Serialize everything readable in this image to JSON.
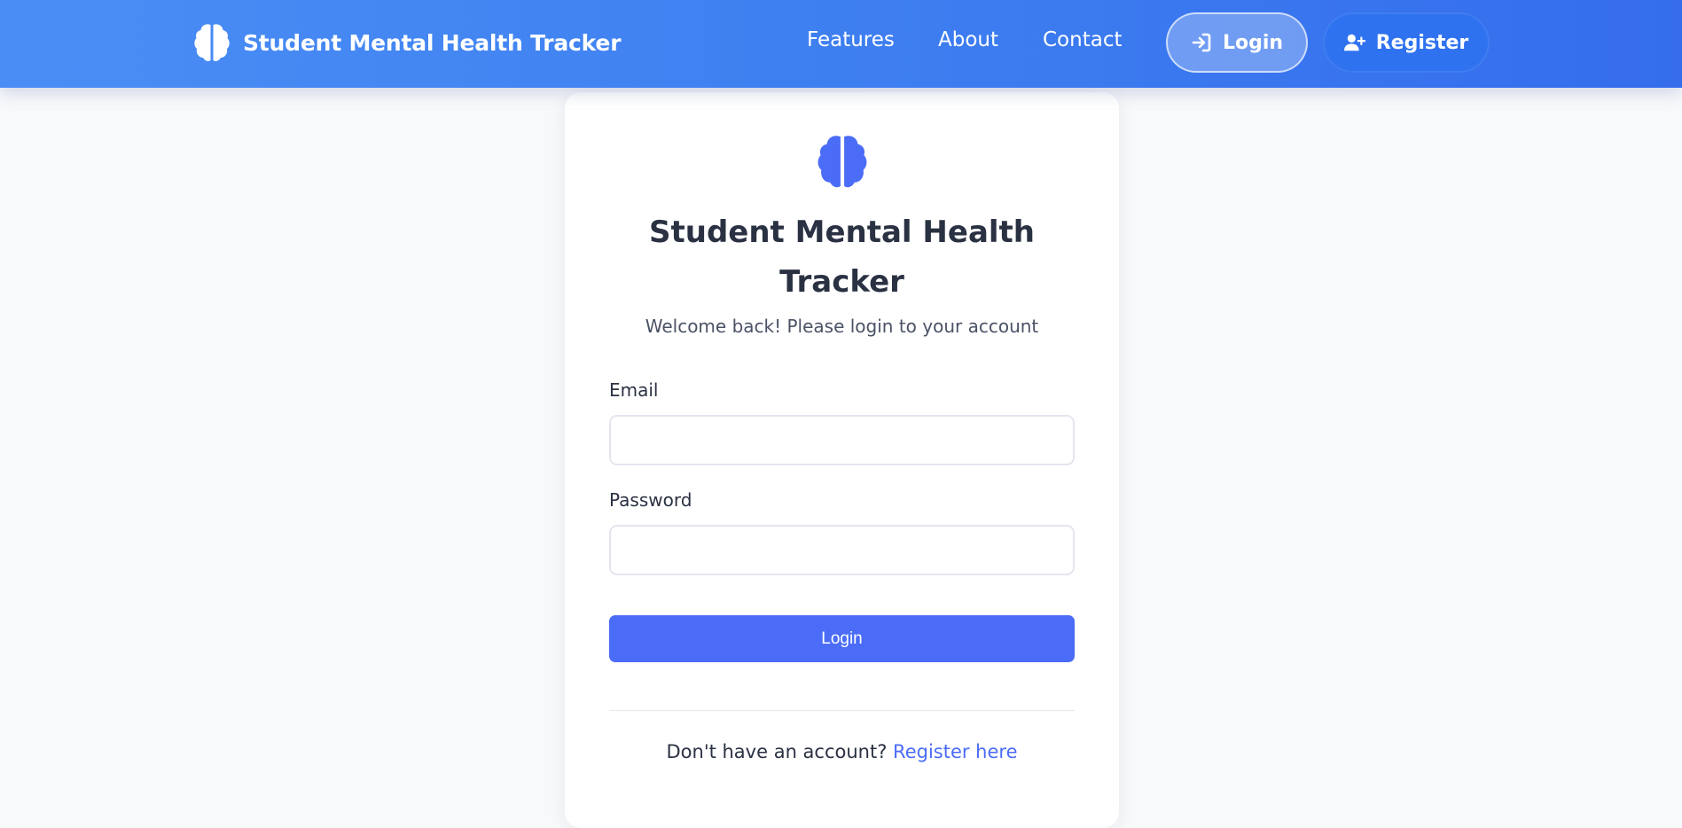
{
  "navbar": {
    "brand_icon": "brain-icon",
    "brand_title": "Student Mental Health Tracker",
    "links": [
      {
        "label": "Features"
      },
      {
        "label": "About"
      },
      {
        "label": "Contact"
      }
    ],
    "login_button": {
      "label": "Login",
      "icon": "sign-in-icon"
    },
    "register_button": {
      "label": "Register",
      "icon": "user-plus-icon"
    },
    "gradient_start": "#4a8ef5",
    "gradient_end": "#356ded"
  },
  "login_card": {
    "icon": "brain-icon",
    "icon_color": "#4a6cf7",
    "title": "Student Mental Health Tracker",
    "subtitle": "Welcome back! Please login to your account",
    "email_label": "Email",
    "email_value": "",
    "password_label": "Password",
    "password_value": "",
    "submit_label": "Login",
    "submit_color": "#4a6cf7",
    "footer_text": "Don't have an account?",
    "footer_link": "Register here"
  }
}
